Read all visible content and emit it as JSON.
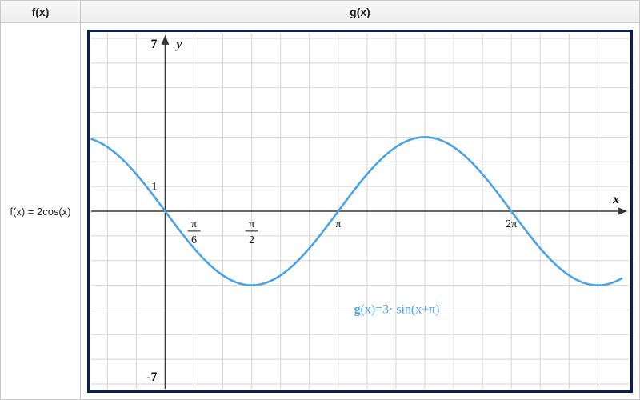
{
  "header": {
    "fx": "f(x)",
    "gx": "g(x)"
  },
  "fx_cell": "f(x) = 2cos(x)",
  "chart_data": {
    "type": "line",
    "title": "",
    "xlabel": "x",
    "ylabel": "y",
    "xlim_label": [
      "",
      ""
    ],
    "ylim": [
      -7,
      7
    ],
    "x_ticks": [
      {
        "label": "π",
        "sub": "6",
        "value": 0.5236
      },
      {
        "label": "π",
        "sub": "2",
        "value": 1.5708
      },
      {
        "label": "π",
        "sub": "",
        "value": 3.1416
      },
      {
        "label": "2π",
        "sub": "",
        "value": 6.2832
      }
    ],
    "y_ticks": [
      {
        "label": "7",
        "value": 7
      },
      {
        "label": "1",
        "value": 1
      },
      {
        "label": "-7",
        "value": -7
      }
    ],
    "series": [
      {
        "name": "g(x)=3·sin(x+π)",
        "amplitude": 3,
        "phase_shift": 3.1416,
        "color": "#4aa3e6"
      }
    ],
    "annotation": {
      "raw": "g(x)=3· sin(x+π)",
      "parts": {
        "g": "g",
        "openx": "(x)",
        "eq": "=3· sin",
        "arg": "(x+π)"
      }
    },
    "grid": true
  }
}
